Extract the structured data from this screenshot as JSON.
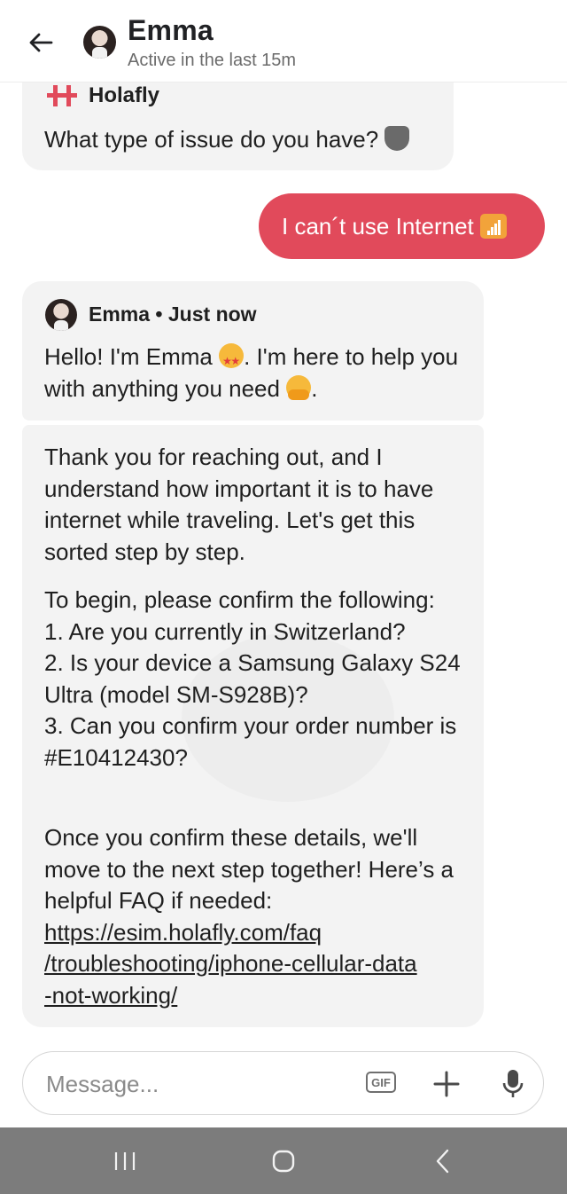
{
  "header": {
    "contact_name": "Emma",
    "status": "Active in the last 15m"
  },
  "messages": {
    "holafly": {
      "brand_name": "Holafly",
      "text": "What type of issue do you have?"
    },
    "user": {
      "text": "I can´t use Internet"
    },
    "emma_greeting": {
      "sender": "Emma",
      "time": "Just now",
      "part1": "Hello! I'm Emma ",
      "part2": ". I'm here to help you with anything you need ",
      "part3": "."
    },
    "emma_reply": {
      "paragraph1": "Thank you for reaching out, and I understand how important it is to have internet while traveling. Let's get this sorted step by step.",
      "paragraph2_intro": "To begin, please confirm the following:",
      "questions": [
        "1. Are you currently in Switzerland?",
        "2. Is your device a Samsung Galaxy S24 Ultra (model SM-S928B)?",
        "3. Can you confirm your order number is #E10412430?"
      ],
      "paragraph3": "Once you confirm these details, we'll move to the next step together! Here’s a helpful FAQ if needed:",
      "faq_link_line1": "https://esim.holafly.com/faq",
      "faq_link_line2": "/troubleshooting/iphone-cellular-data",
      "faq_link_line3": "-not-working/"
    }
  },
  "composer": {
    "placeholder": "Message...",
    "gif_label": "GIF"
  },
  "icons": {
    "back": "arrow-left-icon",
    "gif": "gif-icon",
    "plus": "plus-icon",
    "mic": "microphone-icon",
    "nav_recents": "recents-icon",
    "nav_home": "home-icon",
    "nav_back": "chevron-left-icon"
  },
  "colors": {
    "outgoing_bubble": "#e14a5b",
    "incoming_bubble": "#f3f3f3",
    "brand_red": "#e14a5b",
    "navbar": "#7c7c7c"
  }
}
